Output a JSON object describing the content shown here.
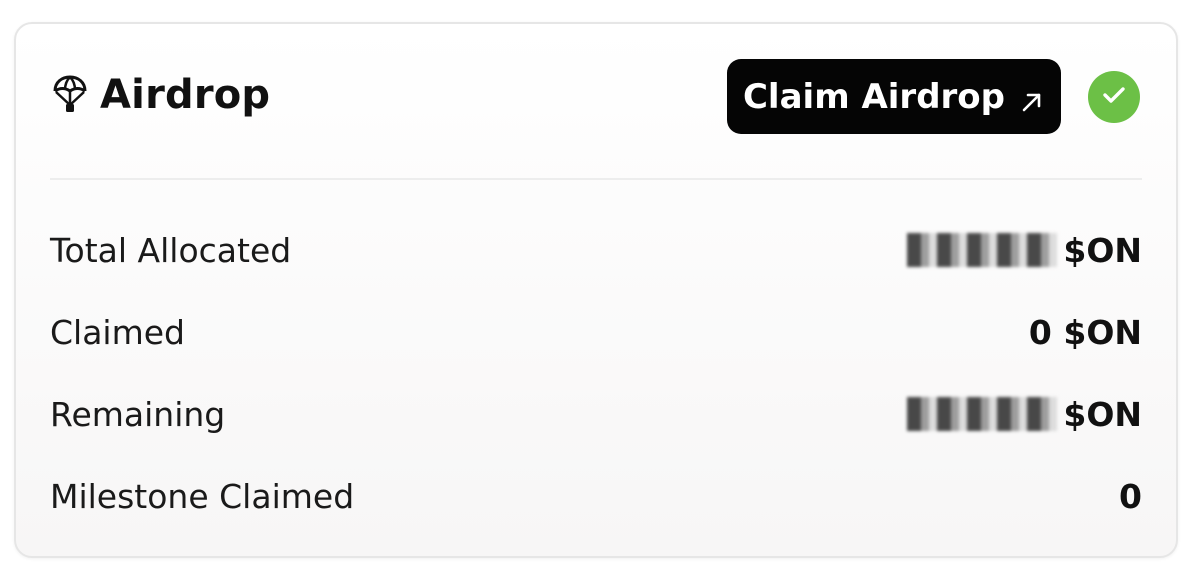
{
  "card": {
    "title": "Airdrop",
    "icons": {
      "title_icon": "parachute-icon",
      "button_icon": "arrow-up-right-icon",
      "status_icon": "check-icon"
    },
    "claim_button_label": "Claim Airdrop",
    "colors": {
      "button_bg": "#050505",
      "button_text": "#ffffff",
      "status_green": "#6cc046"
    },
    "rows": [
      {
        "label": "Total Allocated",
        "value": "$ON",
        "redacted": true
      },
      {
        "label": "Claimed",
        "value": "0 $ON",
        "redacted": false
      },
      {
        "label": "Remaining",
        "value": "$ON",
        "redacted": true
      },
      {
        "label": "Milestone Claimed",
        "value": "0",
        "redacted": false
      }
    ]
  }
}
